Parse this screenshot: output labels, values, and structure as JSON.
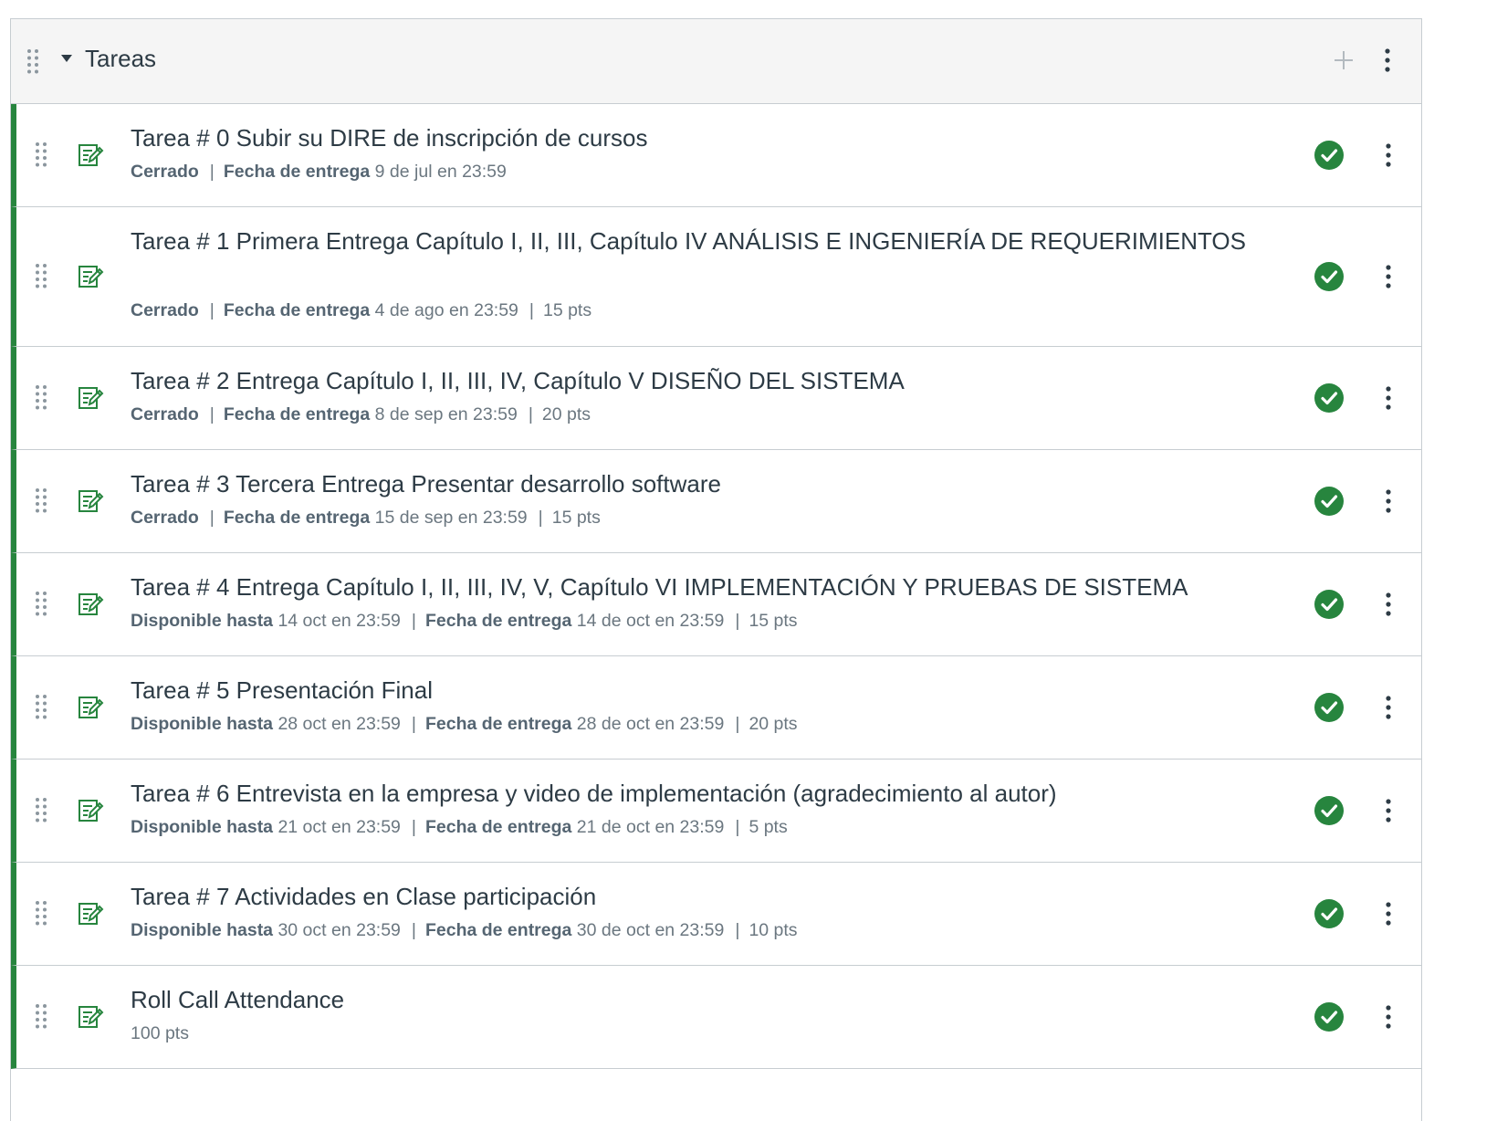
{
  "module": {
    "title": "Tareas",
    "icons": {
      "drag": "drag-handle-icon",
      "collapse": "caret-down-icon",
      "add": "plus-icon",
      "menu": "kebab-menu-icon"
    }
  },
  "colors": {
    "published": "#27853e",
    "border": "#c7cdd1",
    "header_bg": "#f5f5f5"
  },
  "items": [
    {
      "title": "Tarea # 0 Subir su DIRE de inscripción de cursos",
      "status": "Cerrado",
      "due_label": "Fecha de entrega",
      "due": "9 de jul en 23:59",
      "points": ""
    },
    {
      "title": "Tarea # 1 Primera Entrega Capítulo I, II, III, Capítulo IV ANÁLISIS E INGENIERÍA DE REQUERIMIENTOS",
      "status": "Cerrado",
      "due_label": "Fecha de entrega",
      "due": "4 de ago en 23:59",
      "points": "15 pts"
    },
    {
      "title": "Tarea # 2 Entrega Capítulo I, II, III, IV, Capítulo V DISEÑO DEL SISTEMA",
      "status": "Cerrado",
      "due_label": "Fecha de entrega",
      "due": "8 de sep en 23:59",
      "points": "20 pts"
    },
    {
      "title": "Tarea # 3 Tercera Entrega  Presentar desarrollo software",
      "status": "Cerrado",
      "due_label": "Fecha de entrega",
      "due": "15 de sep en 23:59",
      "points": "15 pts"
    },
    {
      "title": "Tarea # 4 Entrega  Capítulo I, II, III, IV, V, Capítulo VI IMPLEMENTACIÓN Y PRUEBAS DE SISTEMA",
      "avail_label": "Disponible hasta",
      "avail": "14 oct en 23:59",
      "due_label": "Fecha de entrega",
      "due": "14 de oct en 23:59",
      "points": "15 pts"
    },
    {
      "title": "Tarea # 5 Presentación Final",
      "avail_label": "Disponible hasta",
      "avail": "28 oct en 23:59",
      "due_label": "Fecha de entrega",
      "due": "28 de oct en 23:59",
      "points": "20 pts"
    },
    {
      "title": "Tarea # 6 Entrevista en la empresa y video de implementación (agradecimiento al autor)",
      "avail_label": "Disponible hasta",
      "avail": "21 oct en 23:59",
      "due_label": "Fecha de entrega",
      "due": "21 de oct en 23:59",
      "points": "5 pts"
    },
    {
      "title": "Tarea # 7 Actividades en Clase participación",
      "avail_label": "Disponible hasta",
      "avail": "30 oct en 23:59",
      "due_label": "Fecha de entrega",
      "due": "30 de oct en 23:59",
      "points": "10 pts"
    },
    {
      "title": "Roll Call Attendance",
      "points": "100 pts"
    }
  ]
}
